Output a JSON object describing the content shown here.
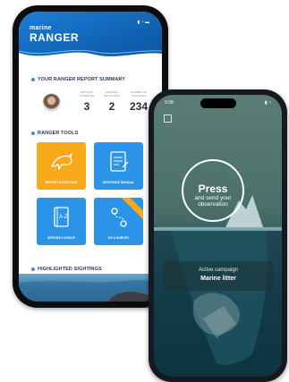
{
  "left_phone": {
    "brand_small": "marine",
    "brand_big": "RANGER",
    "report_summary": {
      "title": "YOUR RANGER REPORT SUMMARY",
      "stats": [
        {
          "label": "REPORTS ACCEPTED",
          "value": "3"
        },
        {
          "label": "RANGERS RECRUITED",
          "value": "2"
        },
        {
          "label": "NUMBER OF SIGHTINGS",
          "value": "234"
        }
      ]
    },
    "tools": {
      "title": "RANGER TOOLS",
      "tiles": [
        {
          "label": "REPORT A SIGHTING",
          "color": "#f7a81b"
        },
        {
          "label": "SIGHTINGS MANUAL",
          "color": "#2b93e8"
        },
        {
          "label": "SPECIES LOOKUP",
          "color": "#2b93e8"
        },
        {
          "label": "DO A SURVEY",
          "color": "#2b93e8"
        }
      ]
    },
    "highlighted": {
      "title": "HIGHLIGHTED SIGHTINGS"
    },
    "icons": [
      "dolphin-icon",
      "manual-icon",
      "book-icon",
      "route-icon"
    ]
  },
  "right_phone": {
    "time": "9:38",
    "press_label": "Press",
    "press_sub": "and send your observation",
    "campaign_caption": "Active campaign",
    "campaign_name": "Marine litter"
  },
  "colors": {
    "brand_blue": "#1c7fd6",
    "tile_yellow": "#f7a81b",
    "tile_blue": "#2b93e8",
    "ocean_dark": "#0a2b36"
  }
}
